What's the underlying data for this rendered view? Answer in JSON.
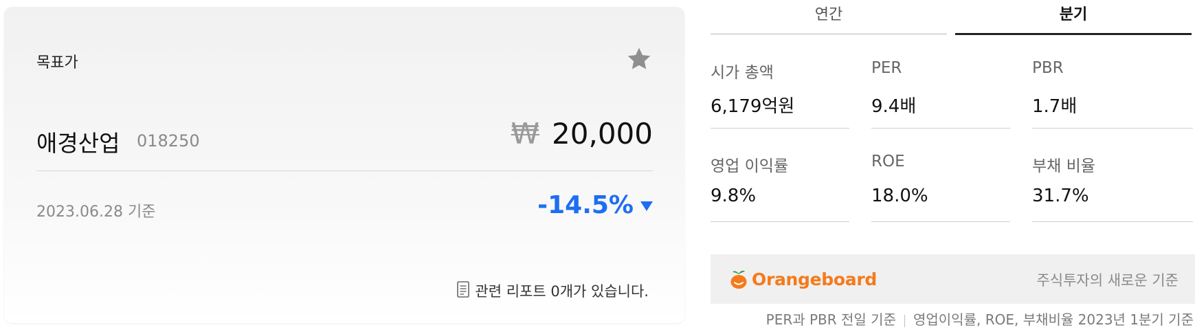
{
  "target_card": {
    "title": "목표가",
    "favorite_icon": "star-icon",
    "company_name": "애경산업",
    "company_code": "018250",
    "currency_symbol": "₩",
    "target_price": "20,000",
    "basis_date": "2023.06.28 기준",
    "change": "-14.5%",
    "change_direction": "down",
    "change_color": "#1d6ef2",
    "report_link": "관련 리포트 0개가 있습니다."
  },
  "tabs": {
    "annual": "연간",
    "quarter": "분기",
    "selected": "quarter"
  },
  "metrics": [
    {
      "label": "시가 총액",
      "value": "6,179억원"
    },
    {
      "label": "PER",
      "value": "9.4배"
    },
    {
      "label": "PBR",
      "value": "1.7배"
    },
    {
      "label": "영업 이익률",
      "value": "9.8%"
    },
    {
      "label": "ROE",
      "value": "18.0%"
    },
    {
      "label": "부채 비율",
      "value": "31.7%"
    }
  ],
  "banner": {
    "brand": "Orangeboard",
    "brand_color": "#f57a1b",
    "tagline": "주식투자의 새로운 기준"
  },
  "footnote": {
    "part1": "PER과 PBR 전일 기준",
    "part2": "영업이익률, ROE, 부채비율 2023년 1분기 기준"
  }
}
